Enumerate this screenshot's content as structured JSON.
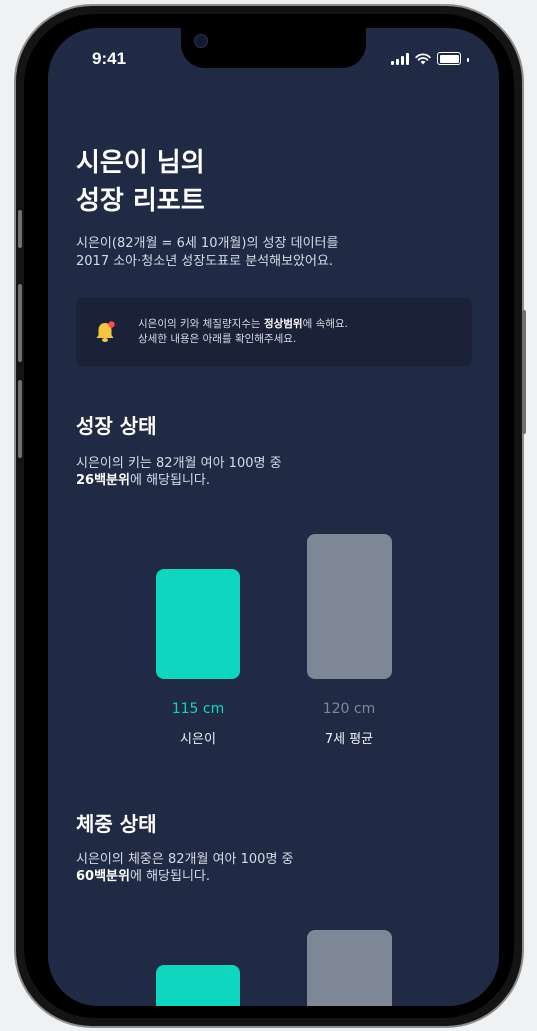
{
  "status_bar": {
    "time": "9:41"
  },
  "report": {
    "title_line1": "시은이 님의",
    "title_line2": "성장 리포트",
    "subtitle_line1": "시은이(82개월 = 6세 10개월)의 성장 데이터를",
    "subtitle_line2": "2017 소아·청소년 성장도표로 분석해보았어요."
  },
  "notice": {
    "line1_prefix": "시은이의 키와 체질량지수는 ",
    "line1_bold": "정상범위",
    "line1_suffix": "에 속해요.",
    "line2": "상세한 내용은 아래를 확인해주세요.",
    "icon": "bell-icon",
    "icon_color": "#f6c443",
    "icon_dot_color": "#ff4b4b"
  },
  "growth": {
    "title": "성장 상태",
    "desc_line1": "시은이의 키는 82개월 여아 100명 중",
    "desc_bold": "26백분위",
    "desc_suffix": "에 해당됩니다.",
    "child_value": "115 cm",
    "child_label": "시은이",
    "avg_value": "120 cm",
    "avg_label": "7세 평균"
  },
  "weight": {
    "title": "체중 상태",
    "desc_line1": "시은이의 체중은 82개월 여아 100명 중",
    "desc_bold": "60백분위",
    "desc_suffix": "에 해당됩니다."
  },
  "colors": {
    "background": "#202a44",
    "accent": "#10d6c0",
    "average_bar": "#7d8796"
  }
}
